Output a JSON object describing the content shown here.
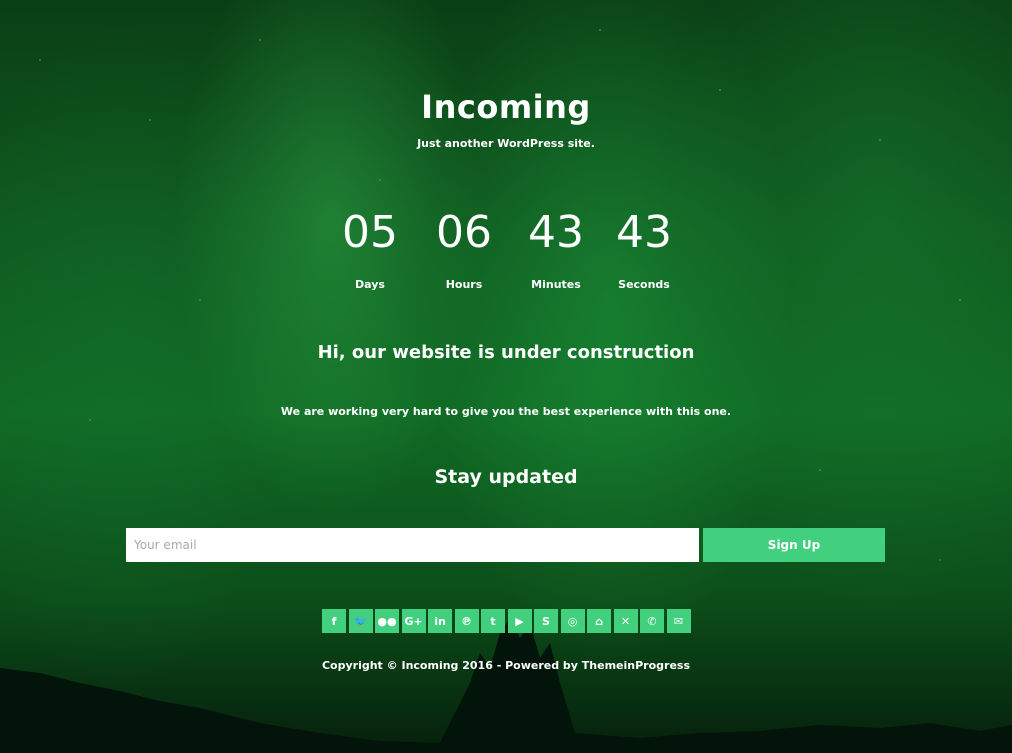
{
  "site": {
    "title": "Incoming",
    "description": "Just another WordPress site."
  },
  "countdown": {
    "days": {
      "value": "05",
      "label": "Days"
    },
    "hours": {
      "value": "06",
      "label": "Hours"
    },
    "minutes": {
      "value": "43",
      "label": "Minutes"
    },
    "seconds": {
      "value": "43",
      "label": "Seconds"
    }
  },
  "main": {
    "heading": "Hi, our website is under construction",
    "subtext": "We are working very hard to give you the best experience with this one."
  },
  "subscribe": {
    "title": "Stay updated",
    "email_placeholder": "Your email",
    "button_label": "Sign Up"
  },
  "social": [
    {
      "name": "facebook-icon",
      "glyph": "f"
    },
    {
      "name": "twitter-icon",
      "glyph": "🐦"
    },
    {
      "name": "flickr-icon",
      "glyph": "●●"
    },
    {
      "name": "google-plus-icon",
      "glyph": "G+"
    },
    {
      "name": "linkedin-icon",
      "glyph": "in"
    },
    {
      "name": "pinterest-icon",
      "glyph": "℗"
    },
    {
      "name": "tumblr-icon",
      "glyph": "t"
    },
    {
      "name": "youtube-icon",
      "glyph": "▶"
    },
    {
      "name": "skype-icon",
      "glyph": "S"
    },
    {
      "name": "instagram-icon",
      "glyph": "◎"
    },
    {
      "name": "github-icon",
      "glyph": "⌂"
    },
    {
      "name": "xing-icon",
      "glyph": "✕"
    },
    {
      "name": "whatsapp-icon",
      "glyph": "✆"
    },
    {
      "name": "email-icon",
      "glyph": "✉"
    }
  ],
  "footer": {
    "copyright": "Copyright © Incoming 2016 - Powered by ThemeinProgress"
  },
  "colors": {
    "accent": "#42d07f",
    "background": "#0f5a1f",
    "text": "#ffffff"
  }
}
